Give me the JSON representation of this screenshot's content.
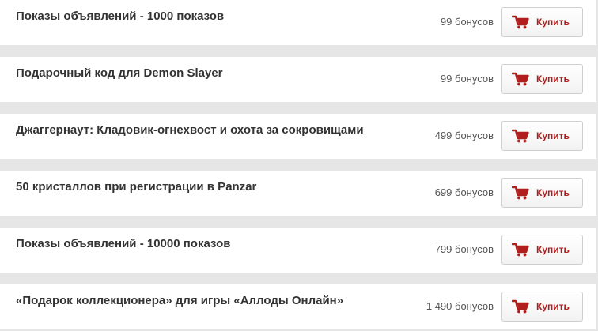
{
  "offers": [
    {
      "title": "Показы объявлений - 1000 показов",
      "price": "99 бонусов",
      "buy_label": "Купить"
    },
    {
      "title": "Подарочный код для Demon Slayer",
      "price": "99 бонусов",
      "buy_label": "Купить"
    },
    {
      "title": "Джаггернаут: Кладовик-огнехвост и охота за сокровищами",
      "price": "499 бонусов",
      "buy_label": "Купить"
    },
    {
      "title": "50 кристаллов при регистрации в Panzar",
      "price": "699 бонусов",
      "buy_label": "Купить"
    },
    {
      "title": "Показы объявлений - 10000 показов",
      "price": "799 бонусов",
      "buy_label": "Купить"
    },
    {
      "title": "«Подарок коллекционера» для игры «Аллоды Онлайн»",
      "price": "1 490 бонусов",
      "buy_label": "Купить"
    }
  ],
  "icons": {
    "buy": "shopping-cart-icon"
  },
  "colors": {
    "accent": "#b01e1e",
    "background": "#e6e6e6",
    "card": "#ffffff"
  }
}
